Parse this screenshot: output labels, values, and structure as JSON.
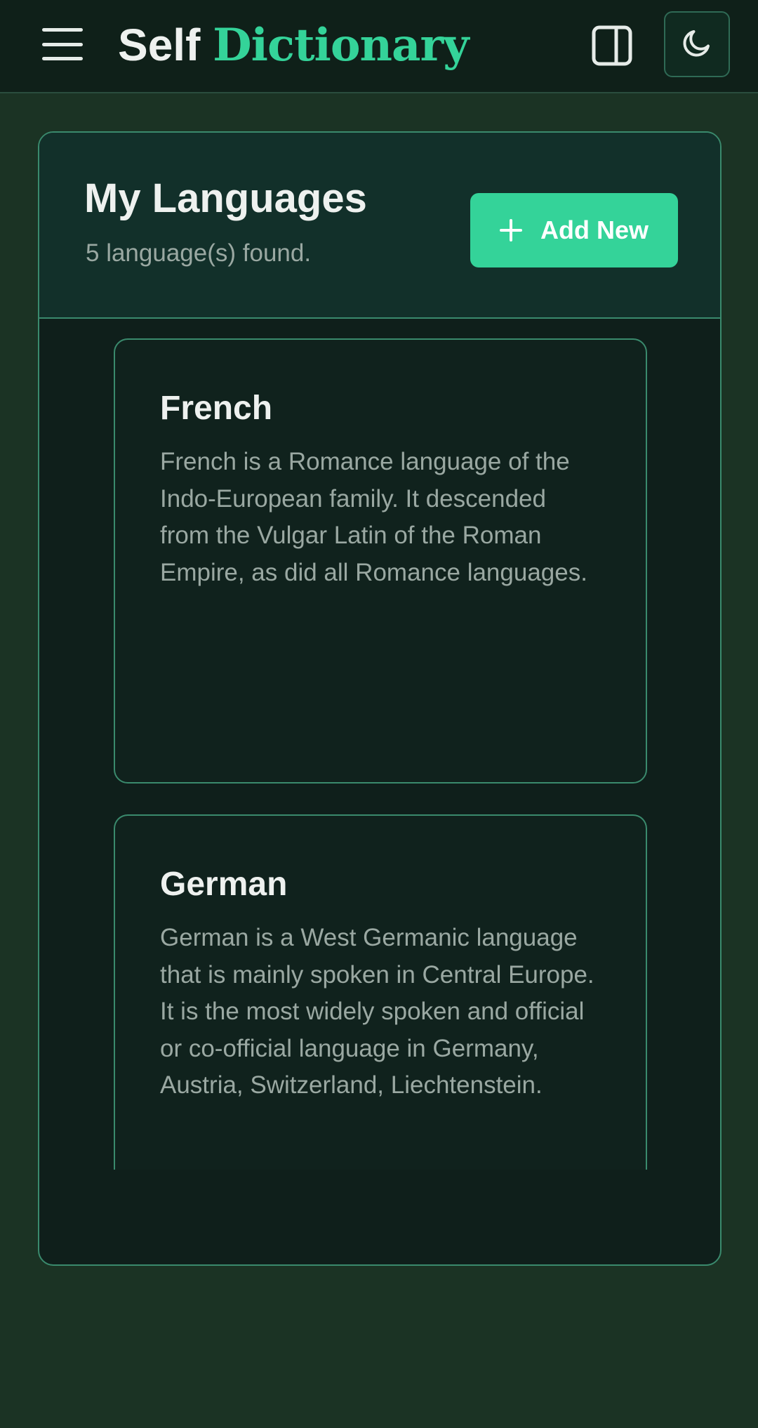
{
  "header": {
    "brand_first": "Self",
    "brand_second": "Dictionary"
  },
  "icons": {
    "menu": "menu-icon",
    "sidebar": "sidebar-toggle-icon",
    "theme": "moon-icon",
    "add": "plus-icon"
  },
  "colors": {
    "accent": "#34d399",
    "background": "#1b3324",
    "header_bg": "#0f2019",
    "panel_border": "#3a8a6d"
  },
  "languages_panel": {
    "title": "My Languages",
    "count_text": "5 language(s) found.",
    "add_label": "Add New"
  },
  "languages": [
    {
      "name": "French",
      "description": "French is a Romance language of the Indo-European family. It descended from the Vulgar Latin of the Roman Empire, as did all Romance languages."
    },
    {
      "name": "German",
      "description": "German is a West Germanic language that is mainly spoken in Central Europe. It is the most widely spoken and official or co-official language in Germany, Austria, Switzerland, Liechtenstein."
    }
  ]
}
